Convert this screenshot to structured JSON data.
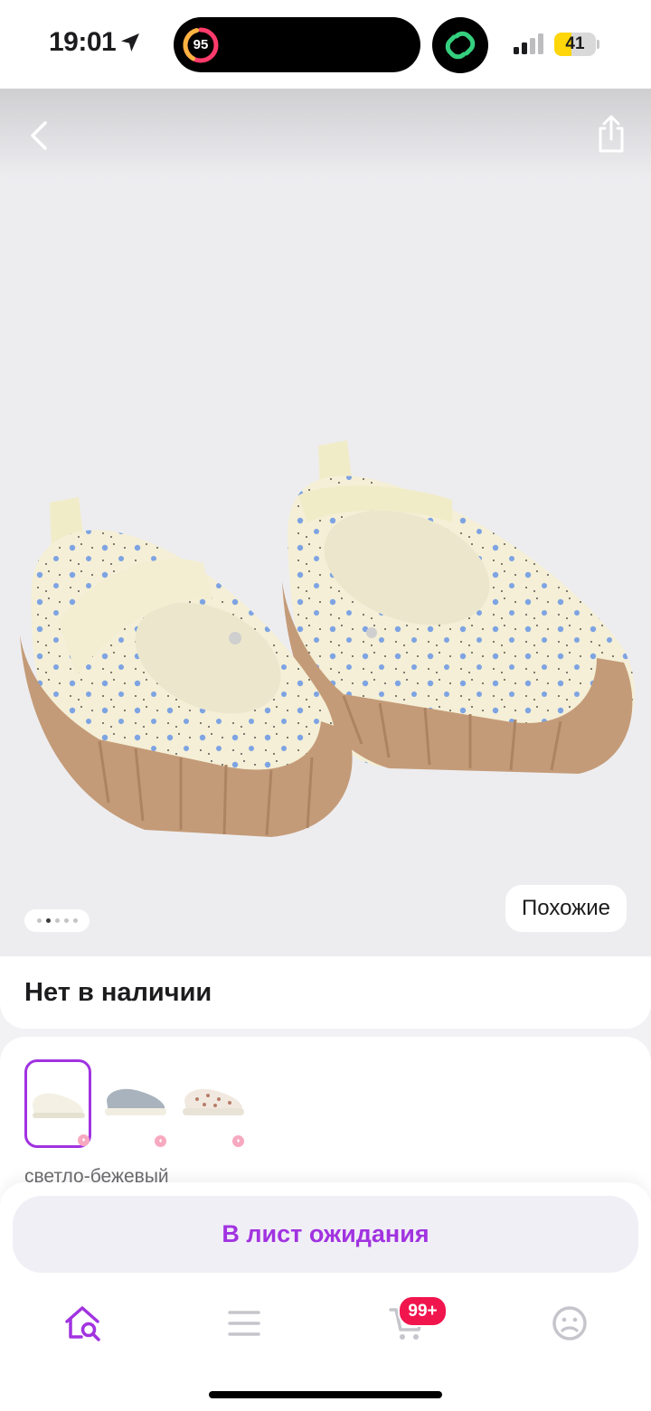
{
  "status_bar": {
    "time": "19:01",
    "activity_ring_value": "95",
    "battery_level": "41",
    "battery_fraction": 0.41
  },
  "gallery": {
    "similar_label": "Похожие",
    "page_count": 5,
    "current_page": 2
  },
  "availability": {
    "label": "Нет в наличии"
  },
  "variants": {
    "selected_color": "светло-бежевый",
    "options": [
      {
        "selected": true
      },
      {
        "selected": false
      },
      {
        "selected": false
      }
    ]
  },
  "actions": {
    "waitlist_label": "В лист ожидания"
  },
  "tab_bar": {
    "cart_badge": "99+",
    "items": [
      "home-search-icon",
      "catalog-menu-icon",
      "cart-icon",
      "profile-icon"
    ],
    "active_index": 0
  },
  "colors": {
    "accent": "#a133e0",
    "badge": "#f1154e",
    "battery": "#ffd60a"
  }
}
